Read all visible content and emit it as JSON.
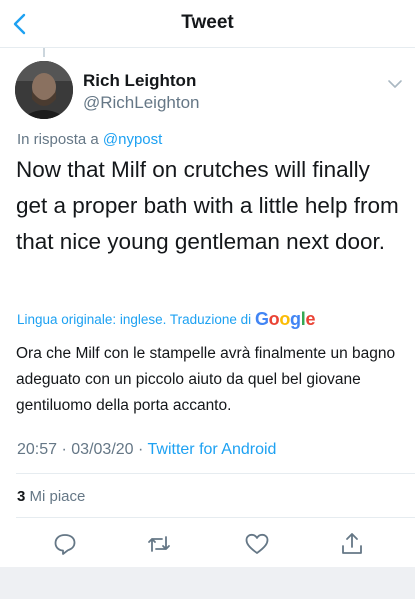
{
  "colors": {
    "accent": "#1da1f2",
    "secondary_text": "#657786",
    "primary_text": "#14171a",
    "divider": "#e6ecf0"
  },
  "nav": {
    "title": "Tweet",
    "back_icon": "chevron-left-icon"
  },
  "author": {
    "name": "Rich Leighton",
    "handle": "@RichLeighton",
    "avatar_icon": "avatar"
  },
  "reply": {
    "prefix": "In risposta a",
    "mention": "@nypost"
  },
  "tweet": {
    "text": "Now that Milf on crutches will finally get a proper bath with a little help from that nice young gentleman next door."
  },
  "translation": {
    "label": "Lingua originale: inglese. Traduzione di",
    "provider": "Google",
    "text": "Ora che Milf con le stampelle avrà finalmente un bagno adeguato con un piccolo aiuto da quel bel giovane gentiluomo della porta accanto."
  },
  "meta": {
    "time": "20:57",
    "separator1": "·",
    "date": "03/03/20",
    "separator2": "·",
    "client": "Twitter for Android"
  },
  "likes": {
    "count": "3",
    "label": "Mi piace"
  },
  "actions": {
    "reply_icon": "reply-icon",
    "retweet_icon": "retweet-icon",
    "like_icon": "heart-icon",
    "share_icon": "share-icon"
  }
}
